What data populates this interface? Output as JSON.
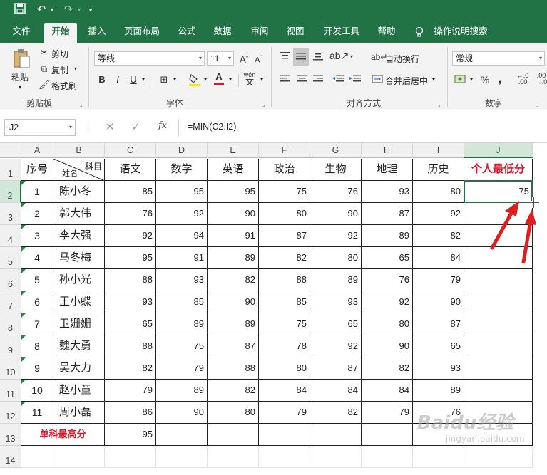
{
  "quick_access": {
    "save_icon": "save-icon",
    "undo_icon": "undo-icon",
    "redo_icon": "redo-icon",
    "customize_icon": "customize-icon"
  },
  "menu": {
    "tabs": [
      "文件",
      "开始",
      "插入",
      "页面布局",
      "公式",
      "数据",
      "审阅",
      "视图",
      "开发工具",
      "帮助"
    ],
    "active_tab": "开始",
    "tell_me": "操作说明搜索"
  },
  "ribbon": {
    "clipboard": {
      "paste": "粘贴",
      "cut": "剪切",
      "copy": "复制",
      "format_painter": "格式刷",
      "label": "剪贴板"
    },
    "font": {
      "font_name": "等线",
      "font_size": "11",
      "label": "字体"
    },
    "alignment": {
      "wrap_text": "自动换行",
      "merge_center": "合并后居中",
      "label": "对齐方式"
    },
    "number": {
      "format": "常规",
      "label": "数字"
    }
  },
  "formula_bar": {
    "name_box": "J2",
    "formula": "=MIN(C2:I2)"
  },
  "sheet": {
    "columns": [
      "A",
      "B",
      "C",
      "D",
      "E",
      "F",
      "G",
      "H",
      "I",
      "J"
    ],
    "rows": [
      "1",
      "2",
      "3",
      "4",
      "5",
      "6",
      "7",
      "8",
      "9",
      "10",
      "11",
      "12",
      "13",
      "14"
    ],
    "selected_cell": "J2",
    "header": {
      "seq": "序号",
      "diag_bottom": "姓名",
      "diag_top": "科目",
      "subjects": [
        "语文",
        "数学",
        "英语",
        "政治",
        "生物",
        "地理",
        "历史"
      ],
      "min_label": "个人最低分"
    },
    "records": [
      {
        "seq": "1",
        "name": "陈小冬",
        "scores": [
          "85",
          "95",
          "95",
          "75",
          "76",
          "93",
          "80"
        ],
        "min": "75"
      },
      {
        "seq": "2",
        "name": "郭大伟",
        "scores": [
          "76",
          "92",
          "90",
          "80",
          "90",
          "87",
          "92"
        ],
        "min": ""
      },
      {
        "seq": "3",
        "name": "李大强",
        "scores": [
          "92",
          "94",
          "91",
          "87",
          "92",
          "89",
          "82"
        ],
        "min": ""
      },
      {
        "seq": "4",
        "name": "马冬梅",
        "scores": [
          "95",
          "91",
          "89",
          "82",
          "80",
          "65",
          "84"
        ],
        "min": ""
      },
      {
        "seq": "5",
        "name": "孙小光",
        "scores": [
          "88",
          "93",
          "82",
          "88",
          "89",
          "76",
          "79"
        ],
        "min": ""
      },
      {
        "seq": "6",
        "name": "王小蝶",
        "scores": [
          "93",
          "85",
          "90",
          "85",
          "93",
          "92",
          "90"
        ],
        "min": ""
      },
      {
        "seq": "7",
        "name": "卫姗姗",
        "scores": [
          "65",
          "89",
          "89",
          "75",
          "65",
          "80",
          "87"
        ],
        "min": ""
      },
      {
        "seq": "8",
        "name": "魏大勇",
        "scores": [
          "88",
          "75",
          "87",
          "78",
          "92",
          "90",
          "65"
        ],
        "min": ""
      },
      {
        "seq": "9",
        "name": "吴大力",
        "scores": [
          "82",
          "79",
          "88",
          "80",
          "87",
          "82",
          "93"
        ],
        "min": ""
      },
      {
        "seq": "10",
        "name": "赵小童",
        "scores": [
          "79",
          "89",
          "82",
          "84",
          "84",
          "84",
          "89"
        ],
        "min": ""
      },
      {
        "seq": "11",
        "name": "周小磊",
        "scores": [
          "86",
          "90",
          "80",
          "79",
          "82",
          "79",
          "76"
        ],
        "min": ""
      }
    ],
    "summary": {
      "label": "单科最高分",
      "values": [
        "95",
        "",
        "",
        "",
        "",
        "",
        ""
      ]
    },
    "highlight_color": "#217346",
    "label_red": "#e0142a",
    "annotation_color": "#e01e1e"
  },
  "watermark": {
    "brand": "Baidu经验",
    "url": "jingyan.baidu.com"
  }
}
